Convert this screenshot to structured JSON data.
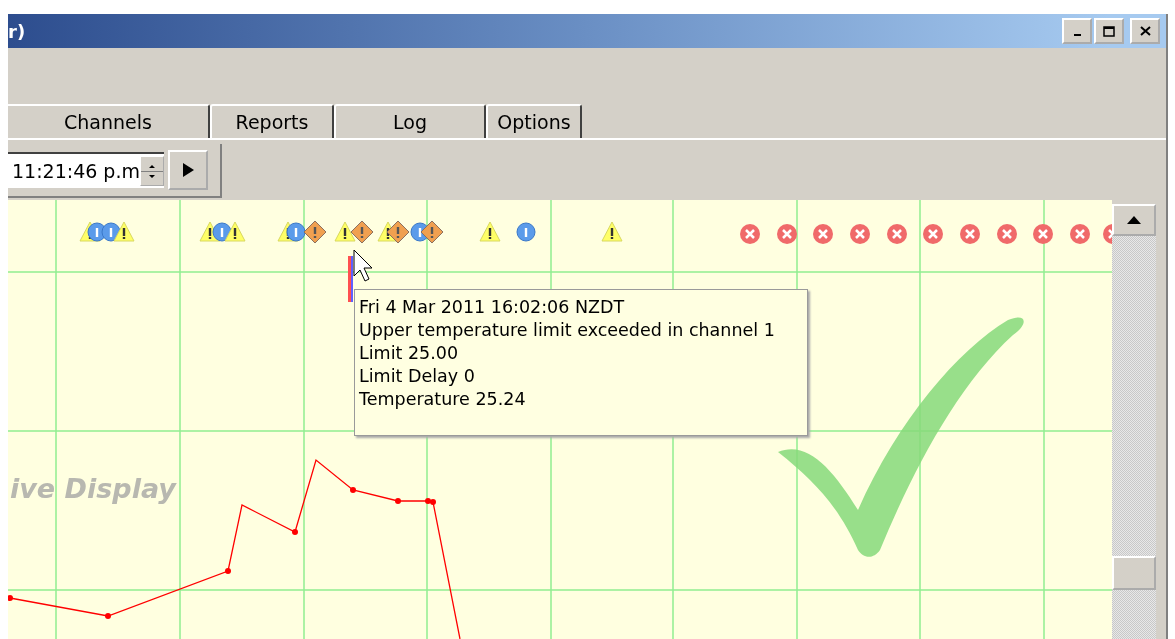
{
  "window": {
    "title": "r)"
  },
  "tabs": [
    {
      "label": "Channels",
      "selected": false
    },
    {
      "label": "Reports",
      "selected": false
    },
    {
      "label": "Log",
      "selected": false
    },
    {
      "label": "Options",
      "selected": false
    }
  ],
  "toolbar": {
    "time_field": {
      "value": "11:21:46 p.m"
    }
  },
  "chart": {
    "watermark": "ive Display",
    "tooltip": [
      "Fri 4 Mar 2011 16:02:06 NZDT",
      "Upper temperature limit exceeded in channel 1",
      "Limit 25.00",
      "Limit Delay 0",
      "Temperature 25.24"
    ]
  }
}
